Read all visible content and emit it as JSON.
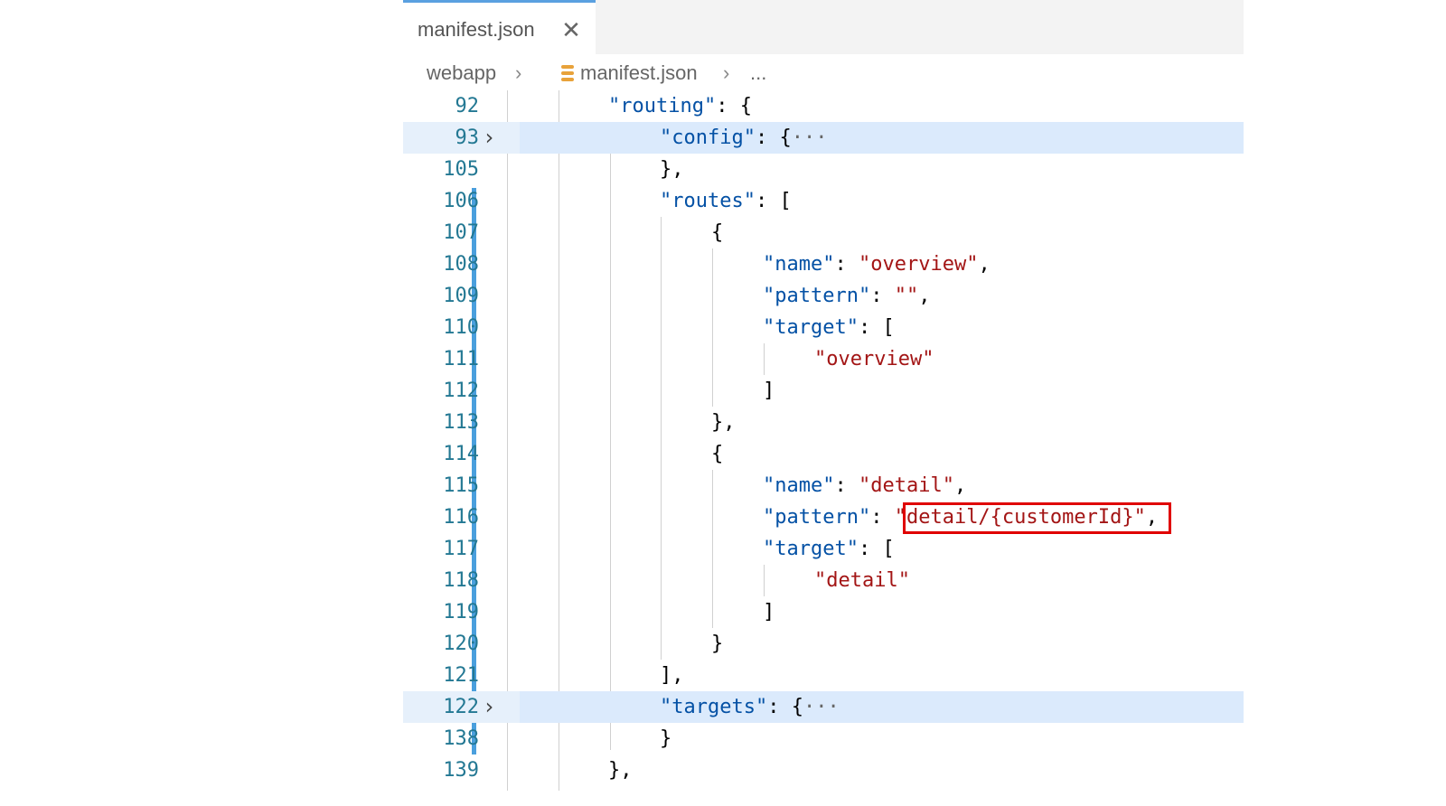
{
  "tab": {
    "title": "manifest.json",
    "close_glyph": "✕"
  },
  "breadcrumb": {
    "folder": "webapp",
    "file": "manifest.json",
    "sep": "›",
    "more": "..."
  },
  "colors": {
    "line_number": "#237893",
    "json_key": "#0451a5",
    "json_string": "#a31515",
    "modified_bar": "#4a9fdd",
    "highlight_box": "#e00000"
  },
  "lines": [
    {
      "n": "92",
      "t1": "\"routing\"",
      "t2": ": {"
    },
    {
      "n": "93",
      "t1": "\"config\"",
      "t2": ": {",
      "t3": "···"
    },
    {
      "n": "105",
      "t1": "},",
      "t2": ""
    },
    {
      "n": "106",
      "t1": "\"routes\"",
      "t2": ": ["
    },
    {
      "n": "107",
      "t1": "{",
      "t2": ""
    },
    {
      "n": "108",
      "t1": "\"name\"",
      "t2": ": ",
      "t3": "\"overview\"",
      "t4": ","
    },
    {
      "n": "109",
      "t1": "\"pattern\"",
      "t2": ": ",
      "t3": "\"\"",
      "t4": ","
    },
    {
      "n": "110",
      "t1": "\"target\"",
      "t2": ": ["
    },
    {
      "n": "111",
      "t1": "\"overview\""
    },
    {
      "n": "112",
      "t1": "]"
    },
    {
      "n": "113",
      "t1": "},"
    },
    {
      "n": "114",
      "t1": "{"
    },
    {
      "n": "115",
      "t1": "\"name\"",
      "t2": ": ",
      "t3": "\"detail\"",
      "t4": ","
    },
    {
      "n": "116",
      "t1": "\"pattern\"",
      "t2": ": ",
      "t3": "\"detail/{customerId}\"",
      "t4": ","
    },
    {
      "n": "117",
      "t1": "\"target\"",
      "t2": ": ["
    },
    {
      "n": "118",
      "t1": "\"detail\""
    },
    {
      "n": "119",
      "t1": "]"
    },
    {
      "n": "120",
      "t1": "}"
    },
    {
      "n": "121",
      "t1": "],"
    },
    {
      "n": "122",
      "t1": "\"targets\"",
      "t2": ": {",
      "t3": "···"
    },
    {
      "n": "138",
      "t1": "}"
    },
    {
      "n": "139",
      "t1": "},"
    }
  ]
}
